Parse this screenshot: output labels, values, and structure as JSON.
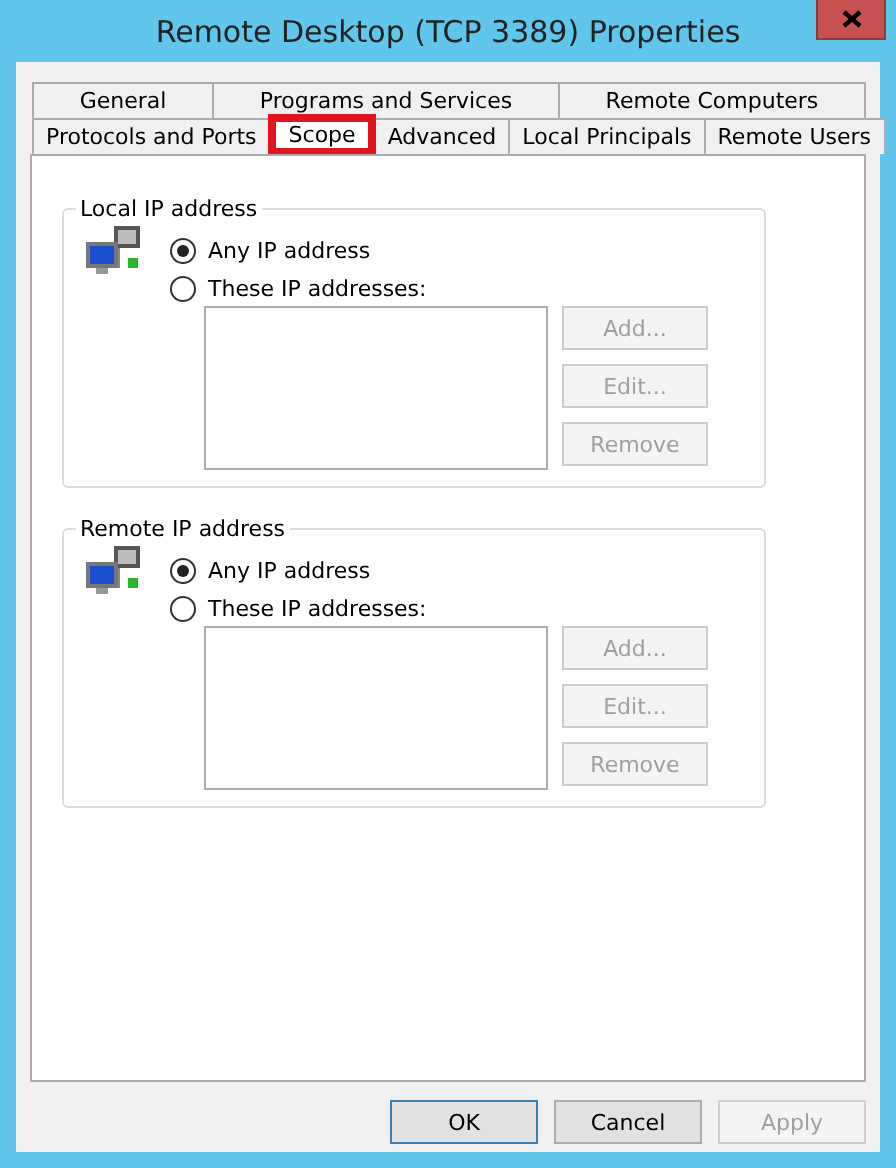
{
  "window": {
    "title": "Remote Desktop (TCP 3389) Properties"
  },
  "tab_rows": [
    {
      "tabs": [
        {
          "label": "General",
          "selected": false,
          "highlighted": false
        },
        {
          "label": "Programs and Services",
          "selected": false,
          "highlighted": false
        },
        {
          "label": "Remote Computers",
          "selected": false,
          "highlighted": false
        }
      ]
    },
    {
      "tabs": [
        {
          "label": "Protocols and Ports",
          "selected": false,
          "highlighted": false
        },
        {
          "label": "Scope",
          "selected": true,
          "highlighted": true
        },
        {
          "label": "Advanced",
          "selected": false,
          "highlighted": false
        },
        {
          "label": "Local Principals",
          "selected": false,
          "highlighted": false
        },
        {
          "label": "Remote Users",
          "selected": false,
          "highlighted": false
        }
      ]
    }
  ],
  "groups": [
    {
      "title": "Local IP address",
      "options": [
        {
          "label": "Any IP address",
          "selected": true
        },
        {
          "label": "These IP addresses:",
          "selected": false
        }
      ],
      "buttons": [
        {
          "label": "Add...",
          "disabled": true
        },
        {
          "label": "Edit...",
          "disabled": true
        },
        {
          "label": "Remove",
          "disabled": true
        }
      ]
    },
    {
      "title": "Remote IP address",
      "options": [
        {
          "label": "Any IP address",
          "selected": true
        },
        {
          "label": "These IP addresses:",
          "selected": false
        }
      ],
      "buttons": [
        {
          "label": "Add...",
          "disabled": true
        },
        {
          "label": "Edit...",
          "disabled": true
        },
        {
          "label": "Remove",
          "disabled": true
        }
      ]
    }
  ],
  "buttons": [
    {
      "label": "OK",
      "disabled": false,
      "default": true
    },
    {
      "label": "Cancel",
      "disabled": false,
      "default": false
    },
    {
      "label": "Apply",
      "disabled": true,
      "default": false
    }
  ]
}
